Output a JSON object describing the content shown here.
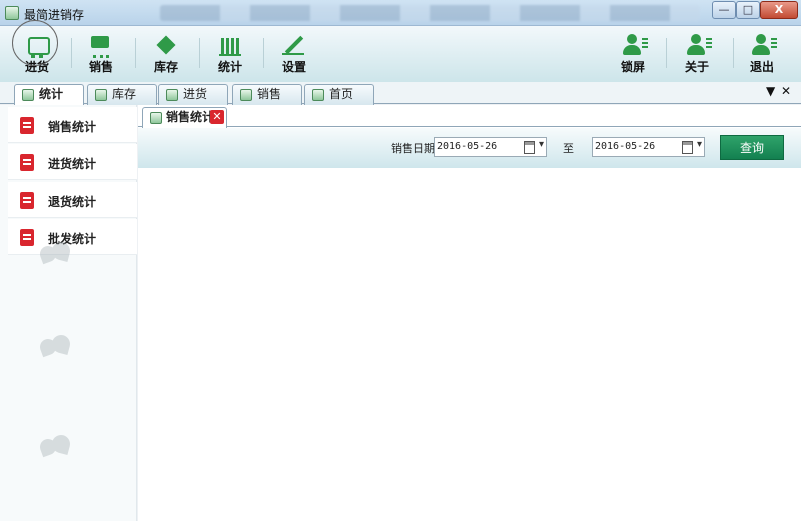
{
  "window": {
    "title": "最简进销存",
    "minimize": "—",
    "maximize": "□",
    "close": "X"
  },
  "toolbar": {
    "items": [
      {
        "label": "进货",
        "icon": "truck-icon"
      },
      {
        "label": "销售",
        "icon": "cart-icon"
      },
      {
        "label": "库存",
        "icon": "box-icon"
      },
      {
        "label": "统计",
        "icon": "chart-icon"
      },
      {
        "label": "设置",
        "icon": "pen-icon"
      },
      {
        "label": "锁屏",
        "icon": "user-icon"
      },
      {
        "label": "关于",
        "icon": "user-icon"
      },
      {
        "label": "退出",
        "icon": "user-icon"
      }
    ]
  },
  "tabs": [
    {
      "label": "统计",
      "active": true
    },
    {
      "label": "库存",
      "active": false
    },
    {
      "label": "进货",
      "active": false
    },
    {
      "label": "销售",
      "active": false
    },
    {
      "label": "首页",
      "active": false
    }
  ],
  "tabstrip_controls": {
    "menu": "▼",
    "close": "✕"
  },
  "leftnav": {
    "items": [
      {
        "label": "销售统计",
        "icon": "notebook-icon"
      },
      {
        "label": "进货统计",
        "icon": "notebook-icon"
      },
      {
        "label": "退货统计",
        "icon": "notebook-icon"
      },
      {
        "label": "批发统计",
        "icon": "notebook-icon"
      }
    ]
  },
  "content": {
    "subtab": {
      "label": "销售统计",
      "close": "✕"
    },
    "filter": {
      "date_label": "销售日期",
      "start_date": "2016-05-26",
      "to_label": "至",
      "end_date": "2016-05-26",
      "query_button": "查询"
    }
  },
  "colors": {
    "accent": "#2f9a48",
    "nav_icon": "#d9262e",
    "query_button": "#138050"
  }
}
